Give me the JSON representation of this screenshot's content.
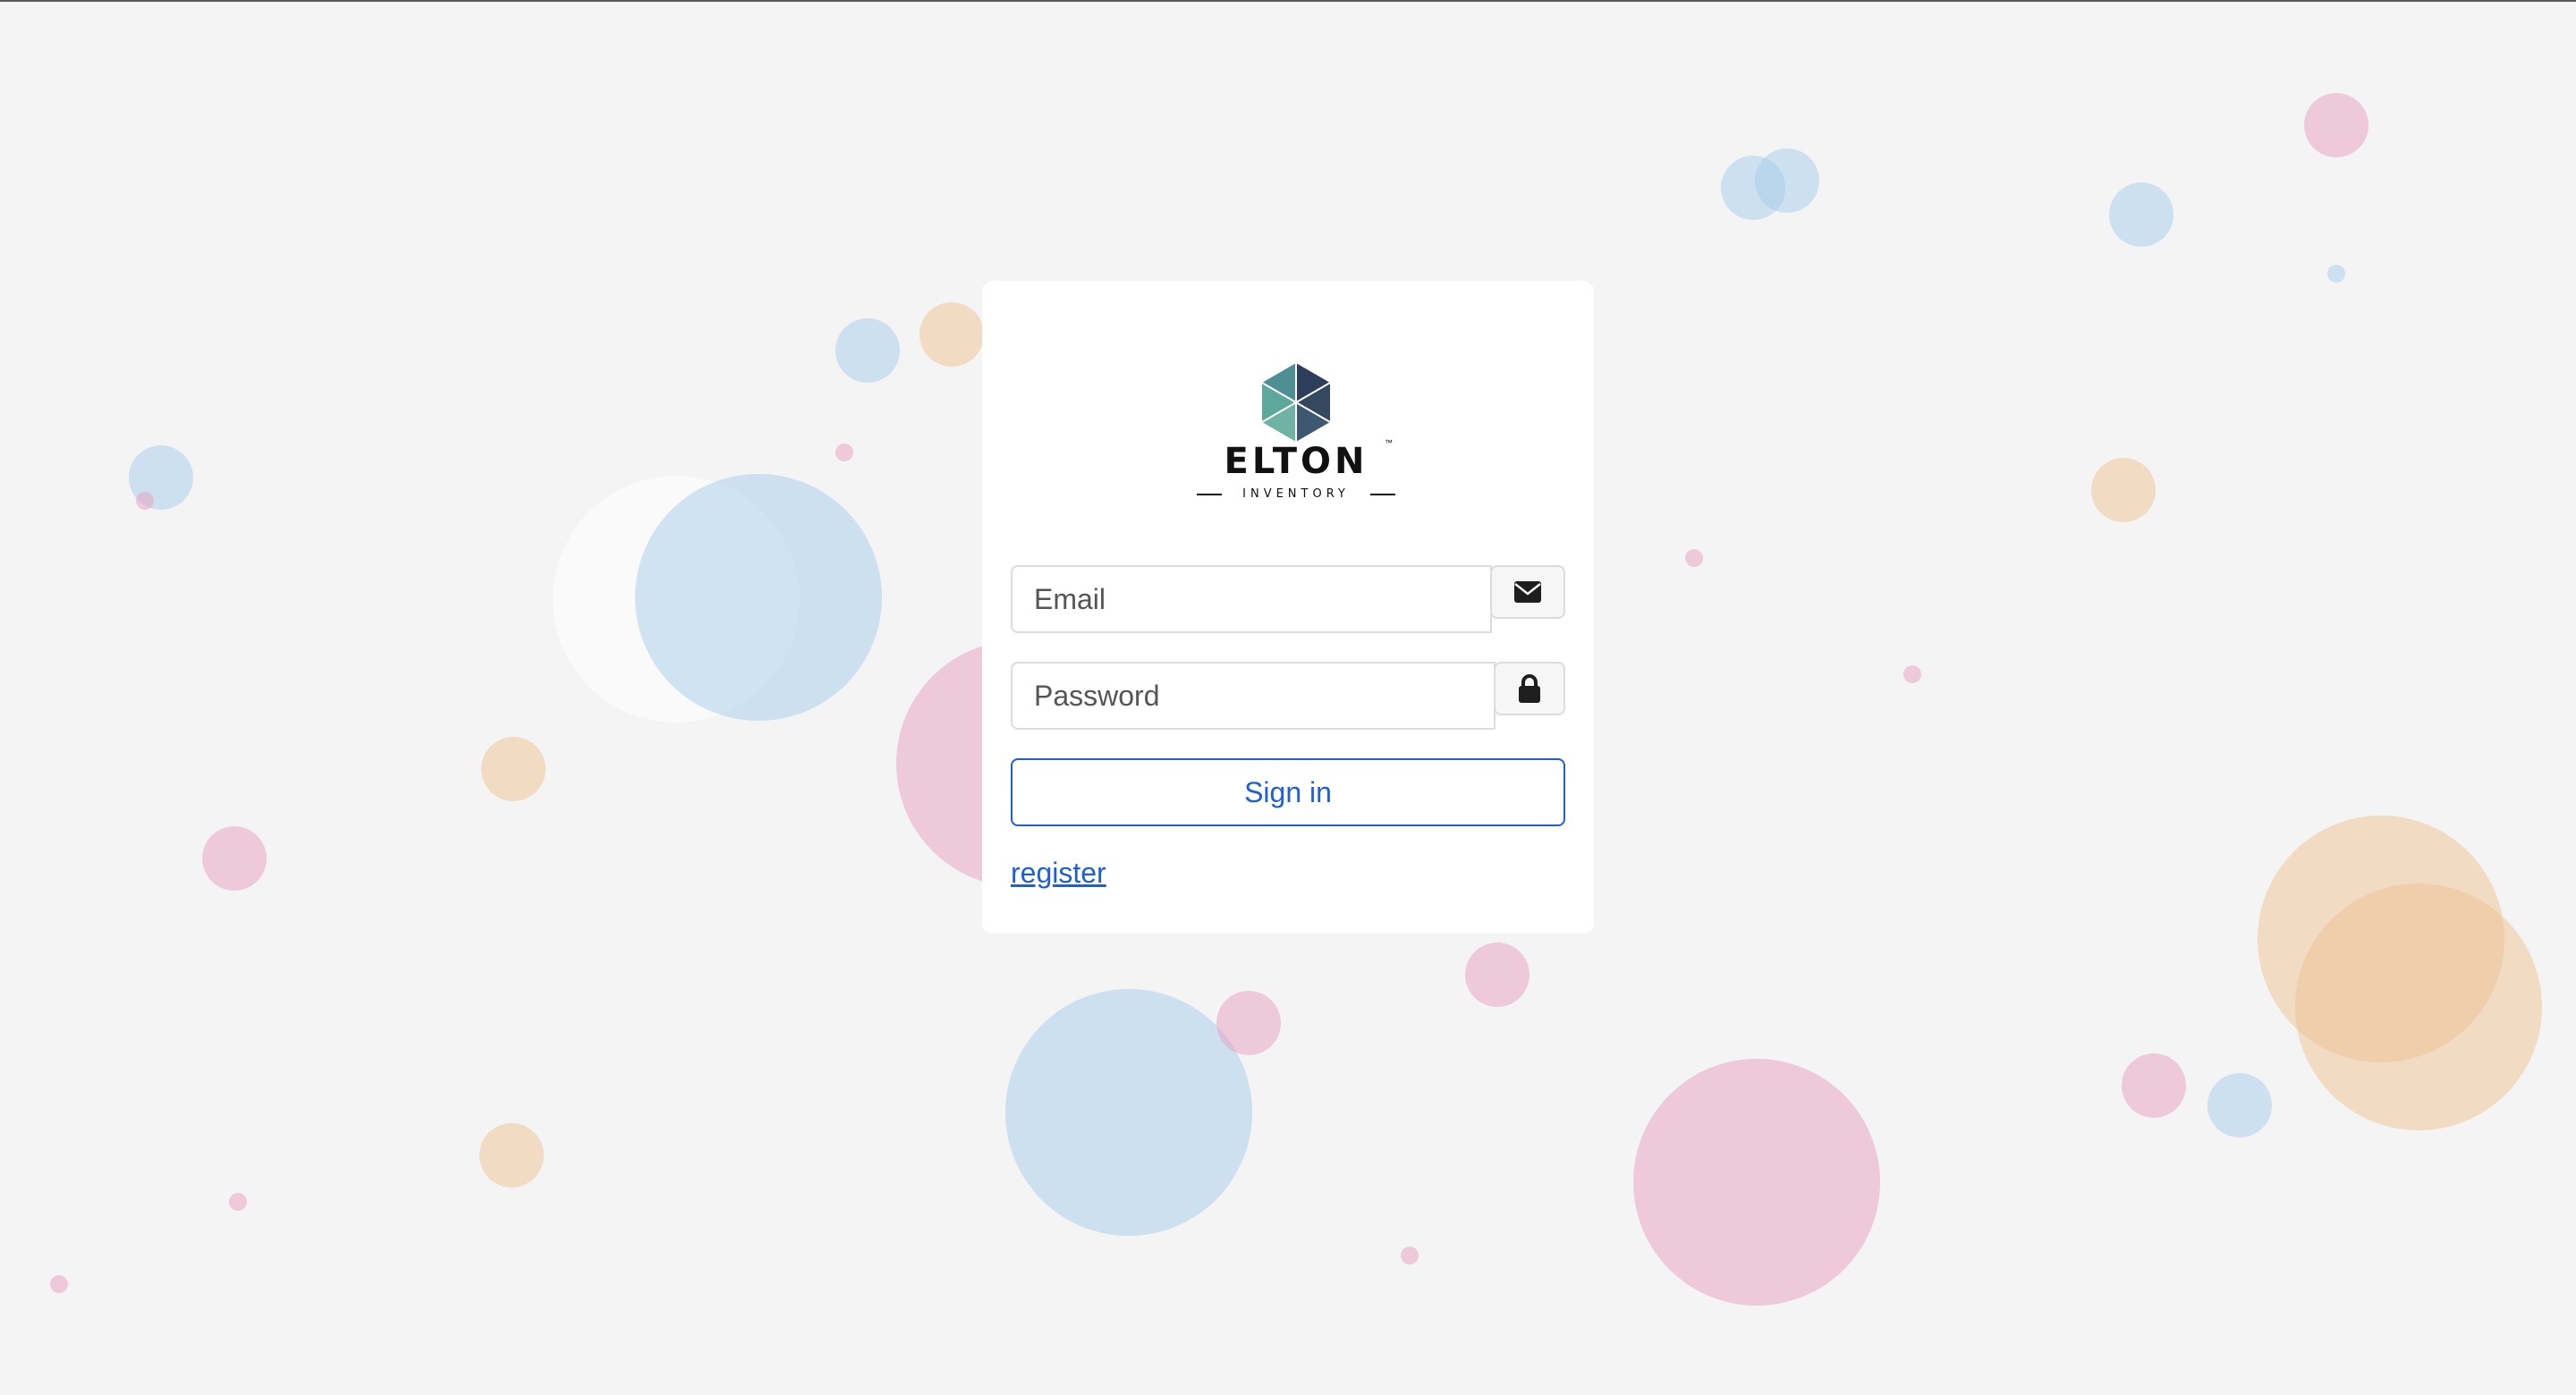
{
  "login": {
    "brand_name": "ELTON",
    "brand_tm": "™",
    "brand_sub": "INVENTORY",
    "email_placeholder": "Email",
    "email_icon": "envelope-icon",
    "password_placeholder": "Password",
    "password_icon": "lock-icon",
    "signin_label": "Sign in",
    "register_label": "register"
  },
  "colors": {
    "page_background": "#f4f4f4",
    "accent": "#1f5fd6",
    "bubble_blue": "#a8cdea",
    "bubble_pink": "#e6a1c1",
    "bubble_orange": "#eec495",
    "logo_teal": "#5ea89b",
    "logo_navy": "#2c3e5c"
  }
}
